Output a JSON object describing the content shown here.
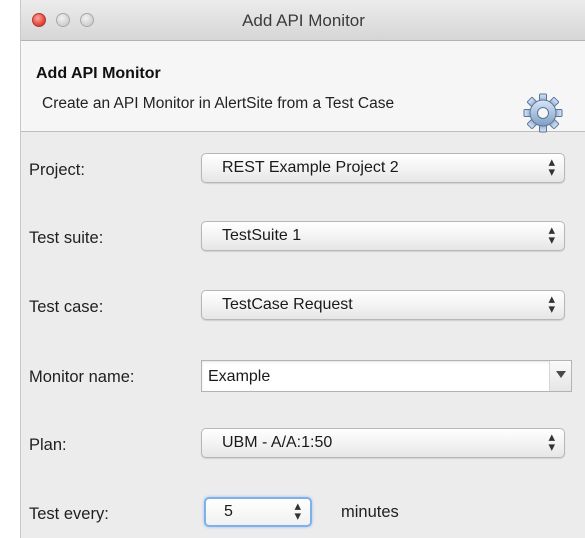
{
  "window": {
    "title": "Add API Monitor"
  },
  "header": {
    "title": "Add API Monitor",
    "description": "Create an API Monitor in AlertSite from a Test Case",
    "icon": "gear-icon"
  },
  "form": {
    "project": {
      "label": "Project:",
      "value": "REST Example Project 2"
    },
    "test_suite": {
      "label": "Test suite:",
      "value": "TestSuite 1"
    },
    "test_case": {
      "label": "Test case:",
      "value": "TestCase Request"
    },
    "monitor_name": {
      "label": "Monitor name:",
      "value": "Example"
    },
    "plan": {
      "label": "Plan:",
      "value": "UBM - A/A:1:50"
    },
    "test_every": {
      "label": "Test every:",
      "value": "5",
      "unit": "minutes"
    }
  },
  "colors": {
    "close_button": "#e0433a",
    "focus_ring": "#7fb0ea",
    "window_background": "#ececec"
  }
}
